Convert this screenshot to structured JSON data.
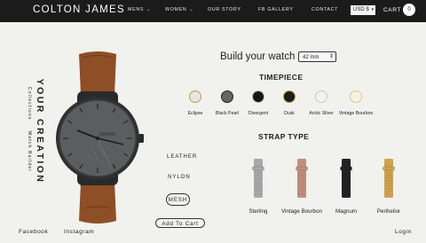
{
  "header": {
    "logo": "COLTON JAMES",
    "nav": [
      {
        "label": "MENS",
        "dropdown": true
      },
      {
        "label": "WOMEN",
        "dropdown": true
      },
      {
        "label": "OUR STORY",
        "dropdown": false
      },
      {
        "label": "FB GALLERY",
        "dropdown": false
      },
      {
        "label": "CONTACT",
        "dropdown": false
      }
    ],
    "currency": "USD $",
    "cart_label": "CART",
    "cart_count": "0"
  },
  "side": {
    "title": "YOUR CREATION",
    "subtitle_1": "Collections",
    "subtitle_2": "Watch Builder"
  },
  "builder": {
    "heading": "Build your watch",
    "size": "42 mm",
    "timepiece_heading": "TIMEPIECE",
    "timepieces": [
      {
        "label": "Eclipse",
        "color": "#e6e6e6",
        "border": "#c79a38"
      },
      {
        "label": "Black Pearl",
        "color": "#666666",
        "border": "#222222"
      },
      {
        "label": "Divergent",
        "color": "#161616",
        "border": "#bbbbbb"
      },
      {
        "label": "Dusk",
        "color": "#1c1c1c",
        "border": "#c79a38"
      },
      {
        "label": "Arctic Silver",
        "color": "#f2f2f2",
        "border": "#c8c8c8"
      },
      {
        "label": "Vintage Bourbon",
        "color": "#f6f2e8",
        "border": "#e2c585"
      }
    ],
    "strap_heading": "STRAP TYPE",
    "materials": [
      "LEATHER",
      "NYLON",
      "MESH"
    ],
    "selected_material": "MESH",
    "straps": [
      {
        "label": "Sterling",
        "color": "#a9a9a9"
      },
      {
        "label": "Vintage Bourbon",
        "color": "#c38e7e"
      },
      {
        "label": "Magnum",
        "color": "#222222"
      },
      {
        "label": "Perihelior",
        "color": "#d1a24c"
      }
    ],
    "add_to_cart": "Add To Cart"
  },
  "footer": {
    "facebook": "Facebook",
    "instagram": "Instagram",
    "login": "Login"
  },
  "colors": {
    "header_bg": "#1b1b1b",
    "page_bg": "#f1f2ee",
    "watch_dial": "#5b5e5f",
    "watch_strap": "#8e4f27"
  }
}
